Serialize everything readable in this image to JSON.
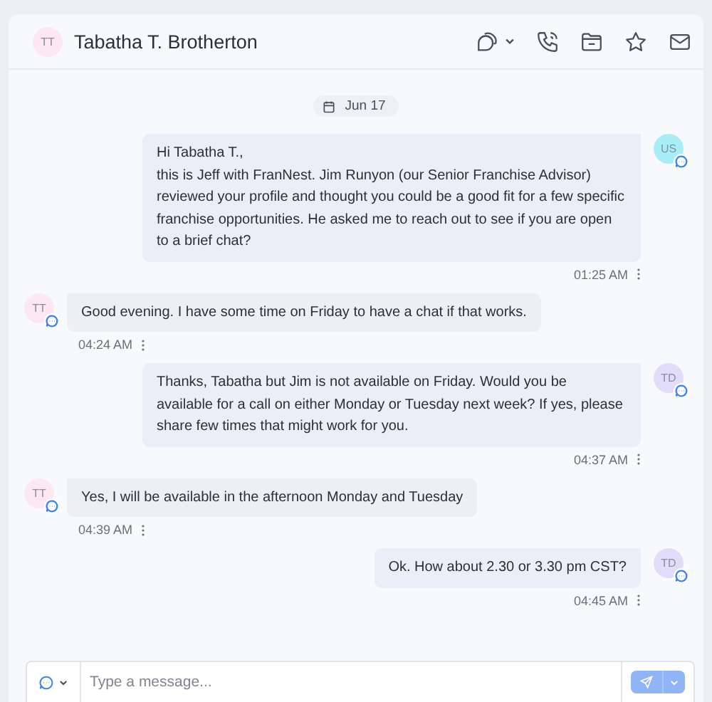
{
  "header": {
    "initials": "TT",
    "name": "Tabatha T. Brotherton"
  },
  "date": "Jun 17",
  "messages": [
    {
      "kind": "outgoing",
      "initials": "US",
      "color": "#a8eef6",
      "text": "Hi Tabatha T.,\nthis is Jeff with FranNest. Jim Runyon (our Senior Franchise Advisor) reviewed your profile and thought you could be a good fit for a few specific franchise opportunities. He asked me to reach out to see if you are open to a brief chat?",
      "time": "01:25 AM"
    },
    {
      "kind": "incoming",
      "initials": "TT",
      "color": "#fde7f0",
      "text": "Good evening. I have some time on Friday to have a chat if that works.",
      "time": "04:24 AM"
    },
    {
      "kind": "outgoing",
      "initials": "TD",
      "color": "#e2dcfb",
      "text": "Thanks, Tabatha but Jim is not available on Friday. Would you be available for a call on either Monday or Tuesday next week? If yes, please share few times that might work for you.",
      "time": "04:37 AM"
    },
    {
      "kind": "incoming",
      "initials": "TT",
      "color": "#fde7f0",
      "text": "Yes, I will be available in the afternoon Monday and Tuesday",
      "time": "04:39 AM"
    },
    {
      "kind": "outgoing",
      "initials": "TD",
      "color": "#e2dcfb",
      "text": "Ok. How about 2.30 or 3.30 pm CST?",
      "time": "04:45 AM"
    }
  ],
  "composer": {
    "placeholder": "Type a message..."
  }
}
